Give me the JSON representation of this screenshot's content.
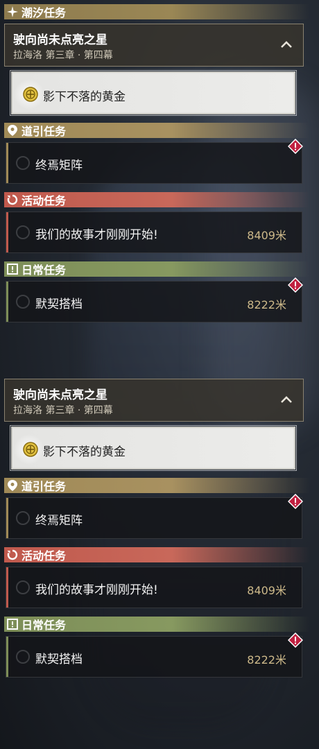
{
  "sections": {
    "tide": "潮汐任务",
    "guide": "道引任务",
    "event": "活动任务",
    "daily": "日常任务"
  },
  "chapter": {
    "title": "驶向尚未点亮之星",
    "subtitle": "拉海洛 第三章 · 第四幕"
  },
  "active_task": {
    "label": "影下不落的黄金"
  },
  "guide_task": {
    "label": "终焉矩阵"
  },
  "event_task": {
    "label": "我们的故事才刚刚开始!",
    "distance": "8409米"
  },
  "daily_task": {
    "label": "默契搭档",
    "distance": "8222米"
  },
  "colors": {
    "tide": "#8e7b4e",
    "guide": "#a08a57",
    "event": "#c0594d",
    "daily": "#7d8e58",
    "distance": "#cdb98a",
    "alert": "#c02040"
  }
}
